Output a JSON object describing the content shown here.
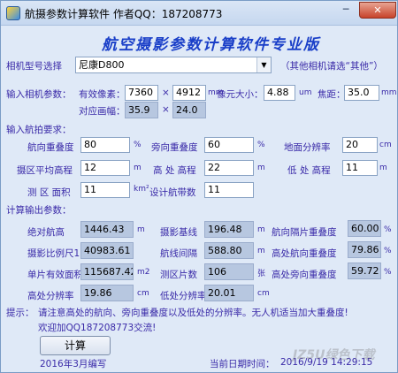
{
  "window": {
    "title": "航摄参数计算软件   作者QQ：187208773",
    "min_glyph": "─",
    "close_glyph": "✕"
  },
  "heading": "航空摄影参数计算软件专业版",
  "camera": {
    "label": "相机型号选择",
    "selected": "尼康D800",
    "hint": "（其他相机请选“其他”）"
  },
  "camera_params": {
    "section": "输入相机参数：",
    "pixels_label": "有效像素：",
    "pixels_w": "7360",
    "x_sign": "×",
    "pixels_h": "4912",
    "mm1": "mm",
    "pixel_size_label": "像元大小：",
    "pixel_size": "4.88",
    "um": "um",
    "focal_label": "焦距：",
    "focal": "35.0",
    "mm2": "mm",
    "frame_label": "对应画幅：",
    "frame_w": "35.9",
    "frame_h": "24.0"
  },
  "flight_req": {
    "section": "输入航拍要求：",
    "heading_overlap_label": "航向重叠度",
    "heading_overlap": "80",
    "pct1": "%",
    "side_overlap_label": "旁向重叠度",
    "side_overlap": "60",
    "pct2": "%",
    "gsd_label": "地面分辨率",
    "gsd": "20",
    "cm": "cm",
    "avg_elev_label": "摄区平均高程",
    "avg_elev": "12",
    "m1": "m",
    "high_elev_label": "高 处 高程",
    "high_elev": "22",
    "m2": "m",
    "low_elev_label": "低 处 高程",
    "low_elev": "11",
    "m3": "m",
    "area_label": "测 区 面积",
    "area": "11",
    "km2": "km²",
    "strips_label": "设计航带数",
    "strips": "11"
  },
  "output": {
    "section": "计算输出参数：",
    "abs_height_label": "绝对航高",
    "abs_height": "1446.43",
    "m_a": "m",
    "baseline_label": "摄影基线",
    "baseline": "196.48",
    "m_b": "m",
    "sep_overlap_label": "航向隔片重叠度",
    "sep_overlap": "60.00",
    "pct_a": "%",
    "scale_label": "摄影比例尺1:",
    "scale": "40983.61",
    "spacing_label": "航线间隔",
    "spacing": "588.80",
    "m_c": "m",
    "high_heading_label": "高处航向重叠度",
    "high_heading": "79.86",
    "pct_b": "%",
    "photo_area_label": "单片有效面积",
    "photo_area": "115687.42",
    "m2_unit": "m2",
    "photo_count_label": "测区片数",
    "photo_count": "106",
    "zhang": "张",
    "high_side_label": "高处旁向重叠度",
    "high_side": "59.72",
    "pct_c": "%",
    "high_res_label": "高处分辨率",
    "high_res": "19.86",
    "cm_a": "cm",
    "low_res_label": "低处分辨率",
    "low_res": "20.01",
    "cm_b": "cm"
  },
  "tip": {
    "label": "提示：",
    "line1": "请注意高处的航向、旁向重叠度以及低处的分辨率。无人机适当加大重叠度!",
    "line2": "欢迎加QQ187208773交流!"
  },
  "calc_button": "计算",
  "footer": {
    "date": "2016年3月编写",
    "current_date_label": "当前日期时间：",
    "current_date": "2016/9/19 14:29:15"
  },
  "watermark": "JZ5U绿色下载"
}
